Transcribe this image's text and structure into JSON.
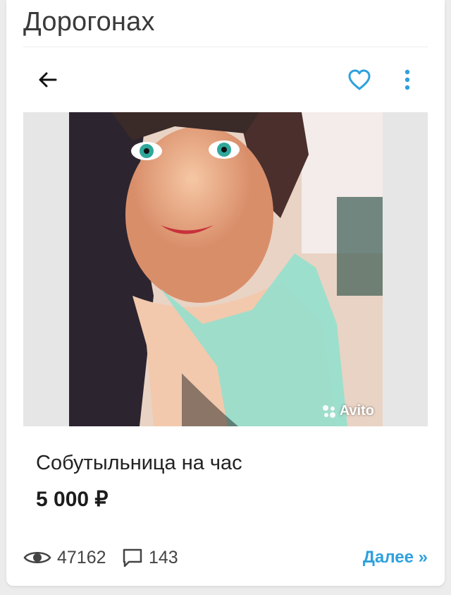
{
  "page": {
    "title": "Дорогонах"
  },
  "toolbar": {
    "back_icon": "arrow-left-icon",
    "favorite_icon": "heart-outline-icon",
    "more_icon": "more-vertical-icon",
    "accent_color": "#2ea1de"
  },
  "listing": {
    "photo_watermark": "Avito",
    "title": "Собутыльница на час",
    "price": "5 000 ₽"
  },
  "stats": {
    "views_icon": "eye-icon",
    "views": "47162",
    "comments_icon": "comment-icon",
    "comments": "143"
  },
  "footer": {
    "more_label": "Далее »",
    "link_color": "#2ea1de"
  }
}
